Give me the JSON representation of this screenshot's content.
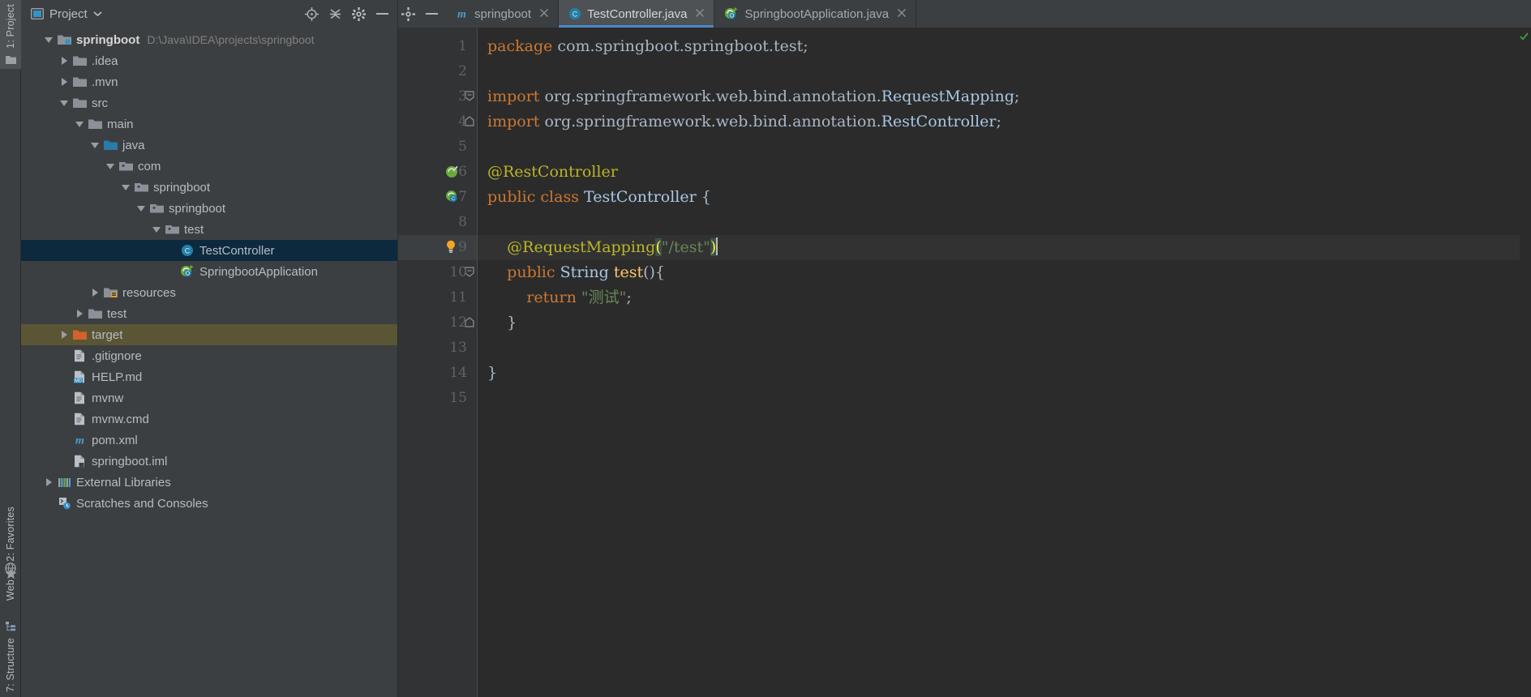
{
  "window": {
    "toolstrip": [
      {
        "label": "1: Project",
        "icon": "project-folder-icon",
        "active": true
      },
      {
        "label": "2: Favorites",
        "icon": "star-icon",
        "active": false
      },
      {
        "label": "Web",
        "icon": "web-globe-icon",
        "active": false
      },
      {
        "label": "7: Structure",
        "icon": "structure-icon",
        "active": false
      }
    ]
  },
  "project_panel": {
    "title": "Project",
    "dropdown_icon": "chevron-down-icon",
    "header_buttons": [
      {
        "name": "locate-icon",
        "title": "Select Opened File"
      },
      {
        "name": "collapse-all-icon",
        "title": "Collapse All"
      },
      {
        "name": "gear-icon",
        "title": "Settings"
      },
      {
        "name": "minimize-icon",
        "title": "Hide"
      }
    ],
    "tree": [
      {
        "label": "springboot",
        "path": "D:\\Java\\IDEA\\projects\\springboot",
        "indent": 0,
        "twisty": "down",
        "icon": "module-folder-icon",
        "bold": true,
        "state": "normal"
      },
      {
        "label": ".idea",
        "path": "",
        "indent": 1,
        "twisty": "right",
        "icon": "folder-icon",
        "bold": false,
        "state": "normal"
      },
      {
        "label": ".mvn",
        "path": "",
        "indent": 1,
        "twisty": "right",
        "icon": "folder-icon",
        "bold": false,
        "state": "normal"
      },
      {
        "label": "src",
        "path": "",
        "indent": 1,
        "twisty": "down",
        "icon": "folder-icon",
        "bold": false,
        "state": "normal"
      },
      {
        "label": "main",
        "path": "",
        "indent": 2,
        "twisty": "down",
        "icon": "folder-icon",
        "bold": false,
        "state": "normal"
      },
      {
        "label": "java",
        "path": "",
        "indent": 3,
        "twisty": "down",
        "icon": "source-folder-icon",
        "bold": false,
        "state": "normal"
      },
      {
        "label": "com",
        "path": "",
        "indent": 4,
        "twisty": "down",
        "icon": "package-icon",
        "bold": false,
        "state": "normal"
      },
      {
        "label": "springboot",
        "path": "",
        "indent": 5,
        "twisty": "down",
        "icon": "package-icon",
        "bold": false,
        "state": "normal"
      },
      {
        "label": "springboot",
        "path": "",
        "indent": 6,
        "twisty": "down",
        "icon": "package-icon",
        "bold": false,
        "state": "normal"
      },
      {
        "label": "test",
        "path": "",
        "indent": 7,
        "twisty": "down",
        "icon": "package-icon",
        "bold": false,
        "state": "normal"
      },
      {
        "label": "TestController",
        "path": "",
        "indent": 8,
        "twisty": "none",
        "icon": "java-class-icon",
        "bold": false,
        "state": "selected"
      },
      {
        "label": "SpringbootApplication",
        "path": "",
        "indent": 8,
        "twisty": "none",
        "icon": "spring-boot-run-icon",
        "bold": false,
        "state": "normal"
      },
      {
        "label": "resources",
        "path": "",
        "indent": 3,
        "twisty": "right",
        "icon": "resources-folder-icon",
        "bold": false,
        "state": "normal"
      },
      {
        "label": "test",
        "path": "",
        "indent": 2,
        "twisty": "right",
        "icon": "folder-icon",
        "bold": false,
        "state": "normal"
      },
      {
        "label": "target",
        "path": "",
        "indent": 1,
        "twisty": "right",
        "icon": "excluded-folder-icon",
        "bold": false,
        "state": "excluded"
      },
      {
        "label": ".gitignore",
        "path": "",
        "indent": 1,
        "twisty": "none",
        "icon": "file-icon",
        "bold": false,
        "state": "normal"
      },
      {
        "label": "HELP.md",
        "path": "",
        "indent": 1,
        "twisty": "none",
        "icon": "markdown-file-icon",
        "bold": false,
        "state": "normal"
      },
      {
        "label": "mvnw",
        "path": "",
        "indent": 1,
        "twisty": "none",
        "icon": "file-icon",
        "bold": false,
        "state": "normal"
      },
      {
        "label": "mvnw.cmd",
        "path": "",
        "indent": 1,
        "twisty": "none",
        "icon": "file-icon",
        "bold": false,
        "state": "normal"
      },
      {
        "label": "pom.xml",
        "path": "",
        "indent": 1,
        "twisty": "none",
        "icon": "maven-icon",
        "bold": false,
        "state": "normal"
      },
      {
        "label": "springboot.iml",
        "path": "",
        "indent": 1,
        "twisty": "none",
        "icon": "iml-file-icon",
        "bold": false,
        "state": "normal"
      },
      {
        "label": "External Libraries",
        "path": "",
        "indent": 0,
        "twisty": "right",
        "icon": "libraries-icon",
        "bold": false,
        "state": "normal"
      },
      {
        "label": "Scratches and Consoles",
        "path": "",
        "indent": 0,
        "twisty": "none",
        "icon": "scratches-icon",
        "bold": false,
        "state": "normal"
      }
    ]
  },
  "editor": {
    "tabs": [
      {
        "label": "springboot",
        "icon": "maven-icon",
        "active": false,
        "close_icon": "close-icon"
      },
      {
        "label": "TestController.java",
        "icon": "java-class-icon",
        "active": true,
        "close_icon": "close-icon"
      },
      {
        "label": "SpringbootApplication.java",
        "icon": "spring-boot-run-icon",
        "active": false,
        "close_icon": "close-icon"
      }
    ],
    "current_line": 9,
    "inspection_status": "ok-check-icon",
    "lines": [
      {
        "n": 1,
        "gutter_icon": "",
        "fold": "",
        "tokens": [
          {
            "t": "package",
            "c": "kw"
          },
          {
            "t": " com.springboot.springboot.test;",
            "c": "plain"
          }
        ]
      },
      {
        "n": 2,
        "gutter_icon": "",
        "fold": "",
        "tokens": []
      },
      {
        "n": 3,
        "gutter_icon": "",
        "fold": "start",
        "tokens": [
          {
            "t": "import",
            "c": "kw"
          },
          {
            "t": " org.springframework.web.bind.annotation.",
            "c": "plain"
          },
          {
            "t": "RequestMapping",
            "c": "type"
          },
          {
            "t": ";",
            "c": "plain"
          }
        ]
      },
      {
        "n": 4,
        "gutter_icon": "",
        "fold": "end",
        "tokens": [
          {
            "t": "import",
            "c": "kw"
          },
          {
            "t": " org.springframework.web.bind.annotation.",
            "c": "plain"
          },
          {
            "t": "RestController",
            "c": "type"
          },
          {
            "t": ";",
            "c": "plain"
          }
        ]
      },
      {
        "n": 5,
        "gutter_icon": "",
        "fold": "",
        "tokens": []
      },
      {
        "n": 6,
        "gutter_icon": "spring-bean-icon",
        "fold": "",
        "tokens": [
          {
            "t": "@RestController",
            "c": "ann"
          }
        ]
      },
      {
        "n": 7,
        "gutter_icon": "spring-class-icon",
        "fold": "",
        "tokens": [
          {
            "t": "public class",
            "c": "kw"
          },
          {
            "t": " ",
            "c": "plain"
          },
          {
            "t": "TestController",
            "c": "type"
          },
          {
            "t": " {",
            "c": "plain"
          }
        ]
      },
      {
        "n": 8,
        "gutter_icon": "",
        "fold": "",
        "tokens": []
      },
      {
        "n": 9,
        "gutter_icon": "lightbulb-icon",
        "fold": "",
        "tokens": [
          {
            "t": "    @RequestMapping",
            "c": "ann"
          },
          {
            "t": "(",
            "c": "brace-hl"
          },
          {
            "t": "\"/test\"",
            "c": "str"
          },
          {
            "t": ")",
            "c": "brace-hl"
          },
          {
            "t": "CARET",
            "c": "caret"
          }
        ]
      },
      {
        "n": 10,
        "gutter_icon": "",
        "fold": "start",
        "tokens": [
          {
            "t": "    ",
            "c": "plain"
          },
          {
            "t": "public",
            "c": "kw"
          },
          {
            "t": " ",
            "c": "plain"
          },
          {
            "t": "String",
            "c": "type"
          },
          {
            "t": " ",
            "c": "plain"
          },
          {
            "t": "test",
            "c": "meth"
          },
          {
            "t": "(){",
            "c": "plain"
          }
        ]
      },
      {
        "n": 11,
        "gutter_icon": "",
        "fold": "",
        "tokens": [
          {
            "t": "        ",
            "c": "plain"
          },
          {
            "t": "return",
            "c": "kw"
          },
          {
            "t": " ",
            "c": "plain"
          },
          {
            "t": "\"测试\"",
            "c": "str"
          },
          {
            "t": ";",
            "c": "plain"
          }
        ]
      },
      {
        "n": 12,
        "gutter_icon": "",
        "fold": "end",
        "tokens": [
          {
            "t": "    }",
            "c": "plain"
          }
        ]
      },
      {
        "n": 13,
        "gutter_icon": "",
        "fold": "",
        "tokens": []
      },
      {
        "n": 14,
        "gutter_icon": "",
        "fold": "",
        "tokens": [
          {
            "t": "}",
            "c": "plain"
          }
        ]
      },
      {
        "n": 15,
        "gutter_icon": "",
        "fold": "",
        "tokens": []
      }
    ]
  },
  "colors": {
    "panel_bg": "#3c3f41",
    "editor_bg": "#2b2b2b",
    "gutter_bg": "#313335",
    "selection": "#0d293e",
    "excluded": "#5a5535",
    "tab_active": "#4e5254",
    "tab_underline": "#4a88c7",
    "keyword": "#cc7832",
    "annotation": "#bbb529",
    "string": "#6a8759",
    "method": "#ffc66d",
    "type": "#a9c7e4",
    "text": "#a9b7c6"
  }
}
